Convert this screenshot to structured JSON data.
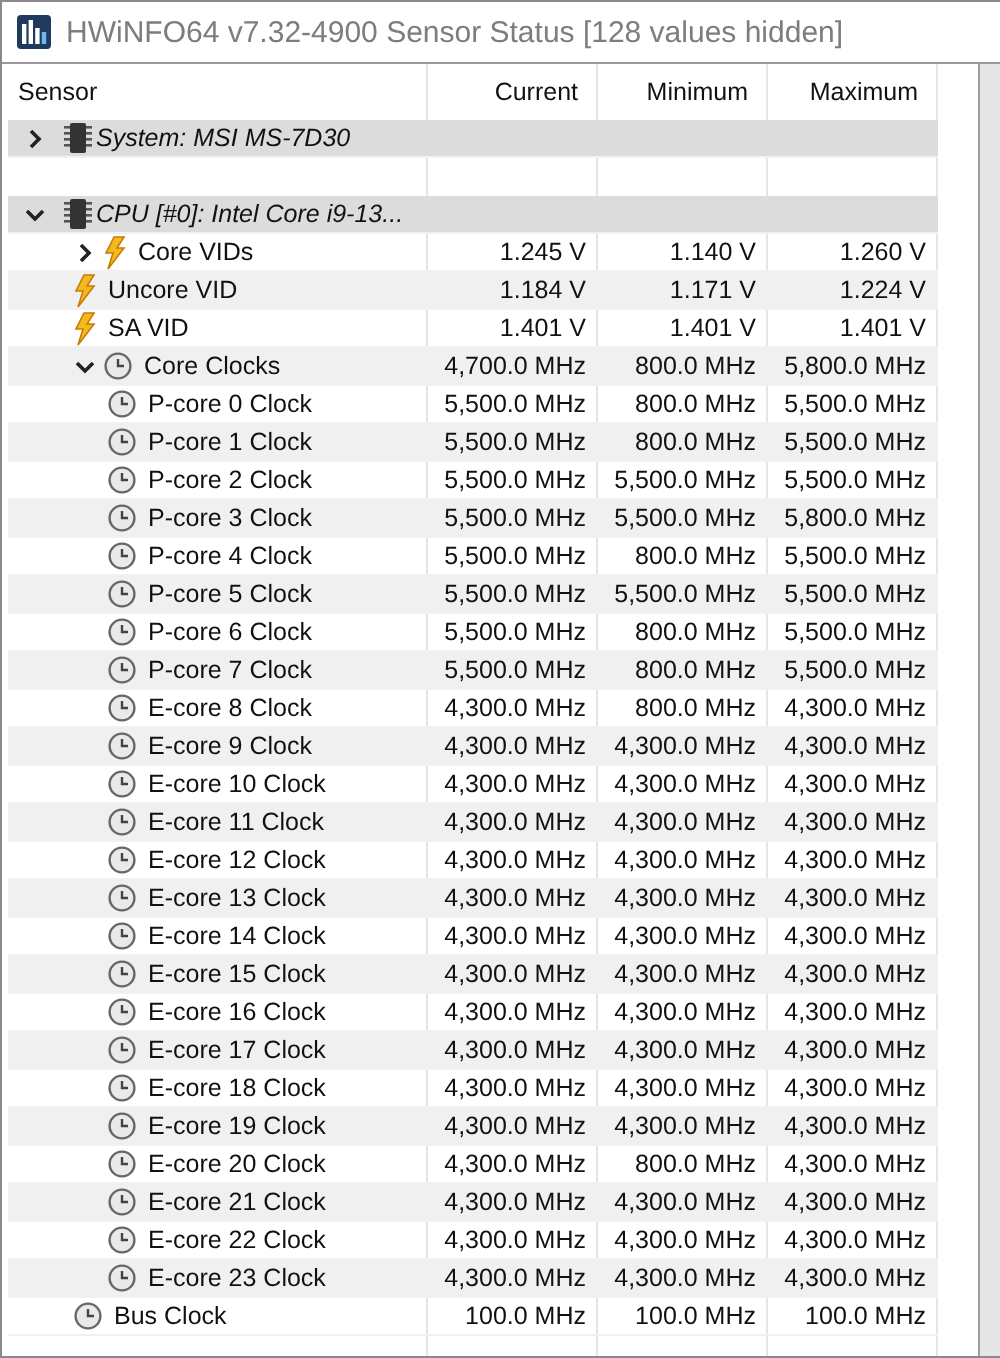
{
  "window": {
    "title": "HWiNFO64 v7.32-4900 Sensor Status [128 values hidden]"
  },
  "table": {
    "columns": [
      "Sensor",
      "Current",
      "Minimum",
      "Maximum"
    ],
    "rows": [
      {
        "kind": "group",
        "label": "System: MSI MS-7D30",
        "expanded": false
      },
      {
        "kind": "spacer"
      },
      {
        "kind": "group",
        "label": "CPU [#0]: Intel Core i9-13...",
        "expanded": true,
        "children": [
          {
            "kind": "voltage",
            "label": "Core VIDs",
            "expanded": false,
            "current": "1.245 V",
            "minimum": "1.140 V",
            "maximum": "1.260 V"
          },
          {
            "kind": "voltage",
            "label": "Uncore VID",
            "current": "1.184 V",
            "minimum": "1.171 V",
            "maximum": "1.224 V"
          },
          {
            "kind": "voltage",
            "label": "SA VID",
            "current": "1.401 V",
            "minimum": "1.401 V",
            "maximum": "1.401 V"
          },
          {
            "kind": "clock",
            "label": "Core Clocks",
            "expanded": true,
            "current": "4,700.0 MHz",
            "minimum": "800.0 MHz",
            "maximum": "5,800.0 MHz",
            "children": [
              {
                "kind": "clock",
                "label": "P-core 0 Clock",
                "current": "5,500.0 MHz",
                "minimum": "800.0 MHz",
                "maximum": "5,500.0 MHz"
              },
              {
                "kind": "clock",
                "label": "P-core 1 Clock",
                "current": "5,500.0 MHz",
                "minimum": "800.0 MHz",
                "maximum": "5,500.0 MHz"
              },
              {
                "kind": "clock",
                "label": "P-core 2 Clock",
                "current": "5,500.0 MHz",
                "minimum": "5,500.0 MHz",
                "maximum": "5,500.0 MHz"
              },
              {
                "kind": "clock",
                "label": "P-core 3 Clock",
                "current": "5,500.0 MHz",
                "minimum": "5,500.0 MHz",
                "maximum": "5,800.0 MHz"
              },
              {
                "kind": "clock",
                "label": "P-core 4 Clock",
                "current": "5,500.0 MHz",
                "minimum": "800.0 MHz",
                "maximum": "5,500.0 MHz"
              },
              {
                "kind": "clock",
                "label": "P-core 5 Clock",
                "current": "5,500.0 MHz",
                "minimum": "5,500.0 MHz",
                "maximum": "5,500.0 MHz"
              },
              {
                "kind": "clock",
                "label": "P-core 6 Clock",
                "current": "5,500.0 MHz",
                "minimum": "800.0 MHz",
                "maximum": "5,500.0 MHz"
              },
              {
                "kind": "clock",
                "label": "P-core 7 Clock",
                "current": "5,500.0 MHz",
                "minimum": "800.0 MHz",
                "maximum": "5,500.0 MHz"
              },
              {
                "kind": "clock",
                "label": "E-core 8 Clock",
                "current": "4,300.0 MHz",
                "minimum": "800.0 MHz",
                "maximum": "4,300.0 MHz"
              },
              {
                "kind": "clock",
                "label": "E-core 9 Clock",
                "current": "4,300.0 MHz",
                "minimum": "4,300.0 MHz",
                "maximum": "4,300.0 MHz"
              },
              {
                "kind": "clock",
                "label": "E-core 10 Clock",
                "current": "4,300.0 MHz",
                "minimum": "4,300.0 MHz",
                "maximum": "4,300.0 MHz"
              },
              {
                "kind": "clock",
                "label": "E-core 11 Clock",
                "current": "4,300.0 MHz",
                "minimum": "4,300.0 MHz",
                "maximum": "4,300.0 MHz"
              },
              {
                "kind": "clock",
                "label": "E-core 12 Clock",
                "current": "4,300.0 MHz",
                "minimum": "4,300.0 MHz",
                "maximum": "4,300.0 MHz"
              },
              {
                "kind": "clock",
                "label": "E-core 13 Clock",
                "current": "4,300.0 MHz",
                "minimum": "4,300.0 MHz",
                "maximum": "4,300.0 MHz"
              },
              {
                "kind": "clock",
                "label": "E-core 14 Clock",
                "current": "4,300.0 MHz",
                "minimum": "4,300.0 MHz",
                "maximum": "4,300.0 MHz"
              },
              {
                "kind": "clock",
                "label": "E-core 15 Clock",
                "current": "4,300.0 MHz",
                "minimum": "4,300.0 MHz",
                "maximum": "4,300.0 MHz"
              },
              {
                "kind": "clock",
                "label": "E-core 16 Clock",
                "current": "4,300.0 MHz",
                "minimum": "4,300.0 MHz",
                "maximum": "4,300.0 MHz"
              },
              {
                "kind": "clock",
                "label": "E-core 17 Clock",
                "current": "4,300.0 MHz",
                "minimum": "4,300.0 MHz",
                "maximum": "4,300.0 MHz"
              },
              {
                "kind": "clock",
                "label": "E-core 18 Clock",
                "current": "4,300.0 MHz",
                "minimum": "4,300.0 MHz",
                "maximum": "4,300.0 MHz"
              },
              {
                "kind": "clock",
                "label": "E-core 19 Clock",
                "current": "4,300.0 MHz",
                "minimum": "4,300.0 MHz",
                "maximum": "4,300.0 MHz"
              },
              {
                "kind": "clock",
                "label": "E-core 20 Clock",
                "current": "4,300.0 MHz",
                "minimum": "800.0 MHz",
                "maximum": "4,300.0 MHz"
              },
              {
                "kind": "clock",
                "label": "E-core 21 Clock",
                "current": "4,300.0 MHz",
                "minimum": "4,300.0 MHz",
                "maximum": "4,300.0 MHz"
              },
              {
                "kind": "clock",
                "label": "E-core 22 Clock",
                "current": "4,300.0 MHz",
                "minimum": "4,300.0 MHz",
                "maximum": "4,300.0 MHz"
              },
              {
                "kind": "clock",
                "label": "E-core 23 Clock",
                "current": "4,300.0 MHz",
                "minimum": "4,300.0 MHz",
                "maximum": "4,300.0 MHz"
              }
            ]
          },
          {
            "kind": "clock",
            "label": "Bus Clock",
            "current": "100.0 MHz",
            "minimum": "100.0 MHz",
            "maximum": "100.0 MHz"
          }
        ]
      }
    ]
  }
}
